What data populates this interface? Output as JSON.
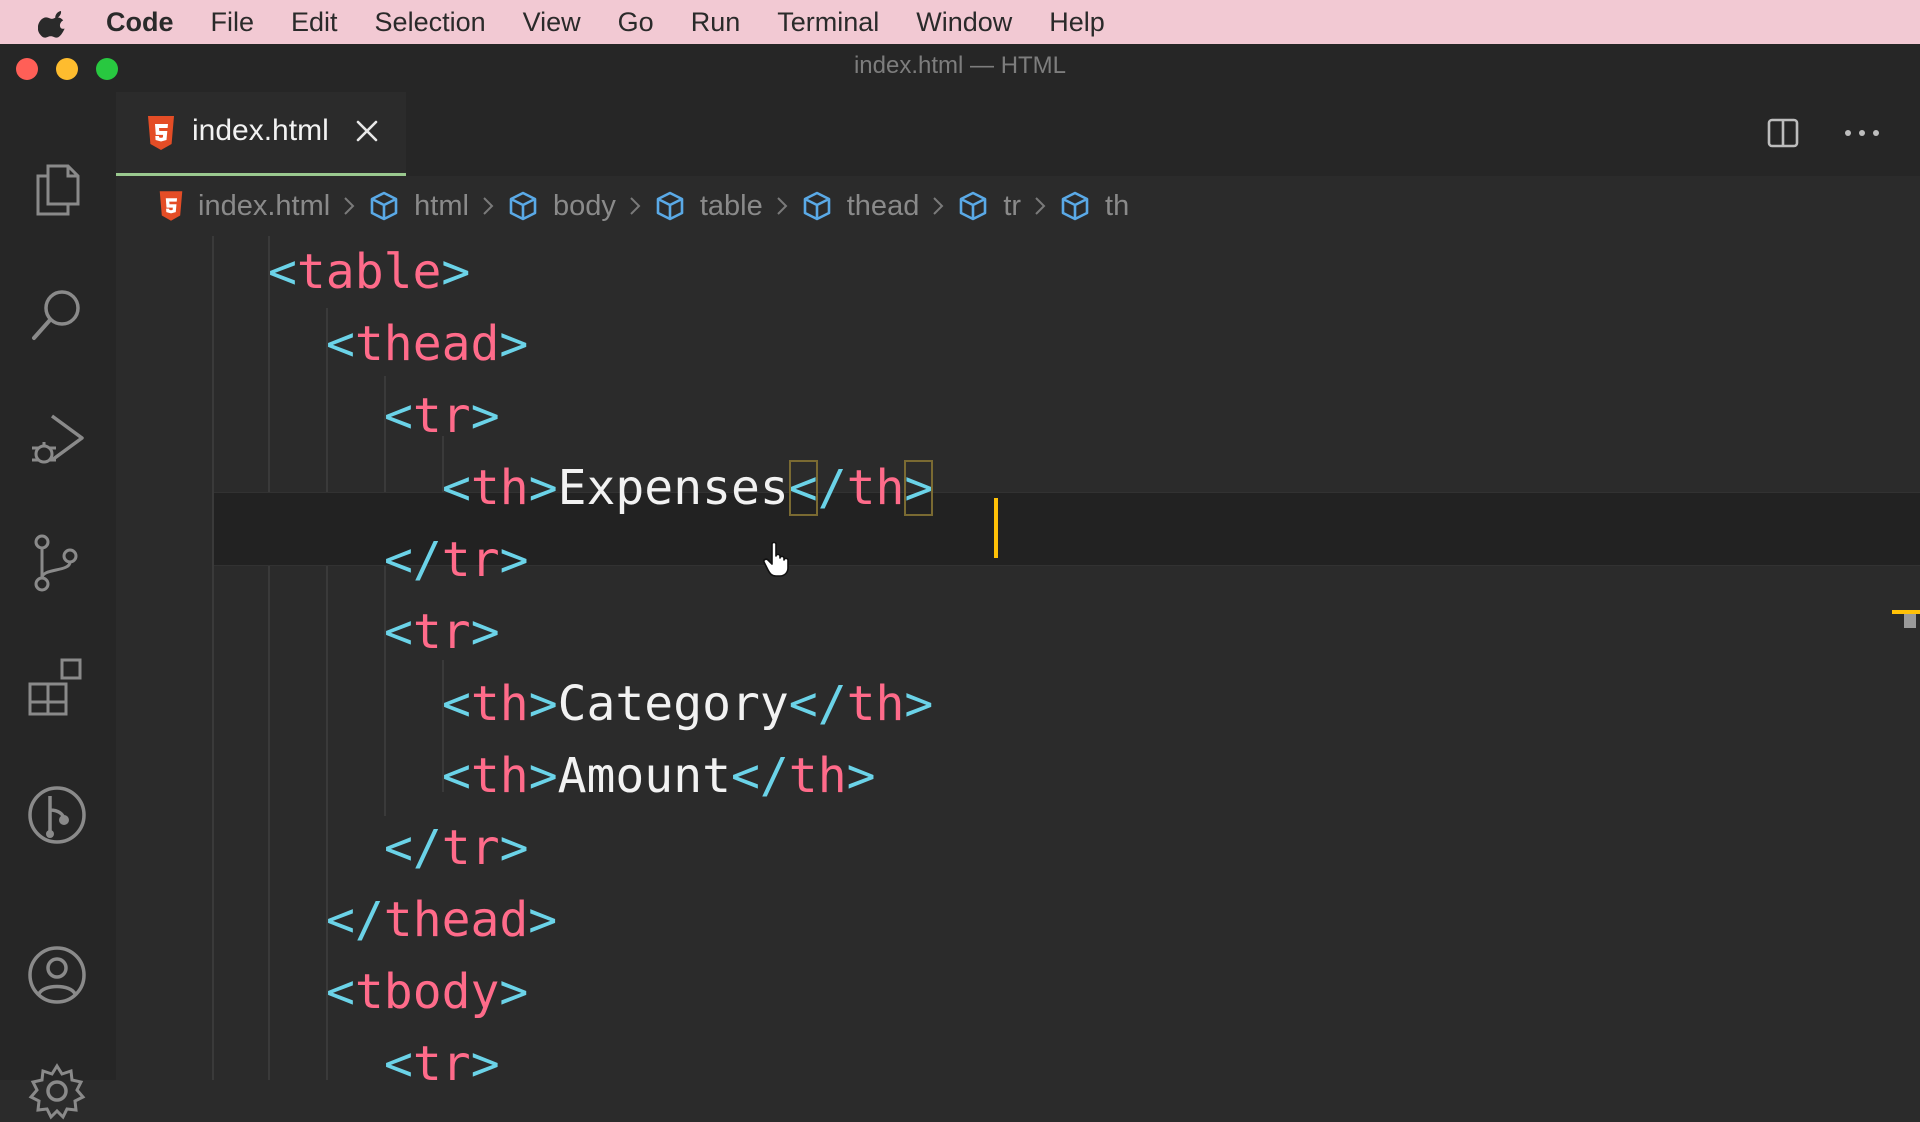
{
  "menubar": {
    "app": "Code",
    "items": [
      "File",
      "Edit",
      "Selection",
      "View",
      "Go",
      "Run",
      "Terminal",
      "Window",
      "Help"
    ]
  },
  "window": {
    "title": "index.html — HTML"
  },
  "tab": {
    "label": "index.html"
  },
  "breadcrumbs": [
    "index.html",
    "html",
    "body",
    "table",
    "thead",
    "tr",
    "th"
  ],
  "editor": {
    "lines": [
      {
        "indent": 1,
        "tokens": [
          [
            "<",
            "pu"
          ],
          [
            "table",
            "tg"
          ],
          [
            ">",
            "pu"
          ]
        ]
      },
      {
        "indent": 2,
        "tokens": [
          [
            "<",
            "pu"
          ],
          [
            "thead",
            "tg"
          ],
          [
            ">",
            "pu"
          ]
        ]
      },
      {
        "indent": 3,
        "tokens": [
          [
            "<",
            "pu"
          ],
          [
            "tr",
            "tg"
          ],
          [
            ">",
            "pu"
          ]
        ]
      },
      {
        "indent": 4,
        "tokens": [
          [
            "<",
            "pu"
          ],
          [
            "th",
            "tg"
          ],
          [
            ">",
            "pu"
          ],
          [
            "Expenses",
            "tx"
          ],
          [
            "<",
            "pu bm"
          ],
          [
            "/",
            "pu"
          ],
          [
            "th",
            "tg"
          ],
          [
            ">",
            "pu bm"
          ]
        ]
      },
      {
        "indent": 3,
        "tokens": [
          [
            "</",
            "pu"
          ],
          [
            "tr",
            "tg"
          ],
          [
            ">",
            "pu"
          ]
        ]
      },
      {
        "indent": 3,
        "tokens": [
          [
            "<",
            "pu"
          ],
          [
            "tr",
            "tg"
          ],
          [
            ">",
            "pu"
          ]
        ]
      },
      {
        "indent": 4,
        "tokens": [
          [
            "<",
            "pu"
          ],
          [
            "th",
            "tg"
          ],
          [
            ">",
            "pu"
          ],
          [
            "Category",
            "tx"
          ],
          [
            "</",
            "pu"
          ],
          [
            "th",
            "tg"
          ],
          [
            ">",
            "pu"
          ]
        ]
      },
      {
        "indent": 4,
        "tokens": [
          [
            "<",
            "pu"
          ],
          [
            "th",
            "tg"
          ],
          [
            ">",
            "pu"
          ],
          [
            "Amount",
            "tx"
          ],
          [
            "</",
            "pu"
          ],
          [
            "th",
            "tg"
          ],
          [
            ">",
            "pu"
          ]
        ]
      },
      {
        "indent": 3,
        "tokens": [
          [
            "</",
            "pu"
          ],
          [
            "tr",
            "tg"
          ],
          [
            ">",
            "pu"
          ]
        ]
      },
      {
        "indent": 2,
        "tokens": [
          [
            "</",
            "pu"
          ],
          [
            "thead",
            "tg"
          ],
          [
            ">",
            "pu"
          ]
        ]
      },
      {
        "indent": 2,
        "tokens": [
          [
            "<",
            "pu"
          ],
          [
            "tbody",
            "tg"
          ],
          [
            ">",
            "pu"
          ]
        ]
      },
      {
        "indent": 3,
        "tokens": [
          [
            "<",
            "pu"
          ],
          [
            "tr",
            "tg"
          ],
          [
            ">",
            "pu"
          ]
        ]
      }
    ]
  },
  "colors": {
    "menubar_bg": "#f2c9d3",
    "editor_bg": "#2b2b2b",
    "tag": "#ff6b8a",
    "punctuation": "#6bd3e8",
    "caret": "#ffc107",
    "tab_underline": "#9ac98f"
  },
  "icons": {
    "activity_bar": [
      "explorer-icon",
      "search-icon",
      "run-debug-icon",
      "source-control-icon",
      "extensions-icon",
      "git-graph-icon",
      "account-icon",
      "settings-gear-icon"
    ]
  }
}
